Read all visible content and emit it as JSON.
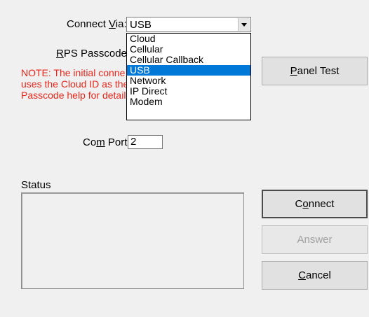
{
  "connect_via": {
    "label_pre": "Connect ",
    "label_mnemonic": "V",
    "label_post": "ia:",
    "selected": "USB",
    "options": [
      "Cloud",
      "Cellular",
      "Cellular Callback",
      "USB",
      "Network",
      "IP Direct",
      "Modem"
    ],
    "selected_index": 3
  },
  "rps_passcode": {
    "label_mnemonic": "R",
    "label_post": "PS Passcode:"
  },
  "note_lines": [
    "NOTE: The initial conne",
    "uses the Cloud ID as the",
    "Passcode help for detail"
  ],
  "panel_test": {
    "mnemonic": "P",
    "rest": "anel Test"
  },
  "com_port": {
    "label_pre": "Co",
    "label_mnemonic": "m",
    "label_post": " Port:",
    "value": "2"
  },
  "status_label": "Status",
  "buttons": {
    "connect": {
      "pre": "C",
      "mnemonic": "o",
      "post": "nnect"
    },
    "answer": {
      "label": "Answer"
    },
    "cancel": {
      "mnemonic": "C",
      "post": "ancel"
    }
  }
}
